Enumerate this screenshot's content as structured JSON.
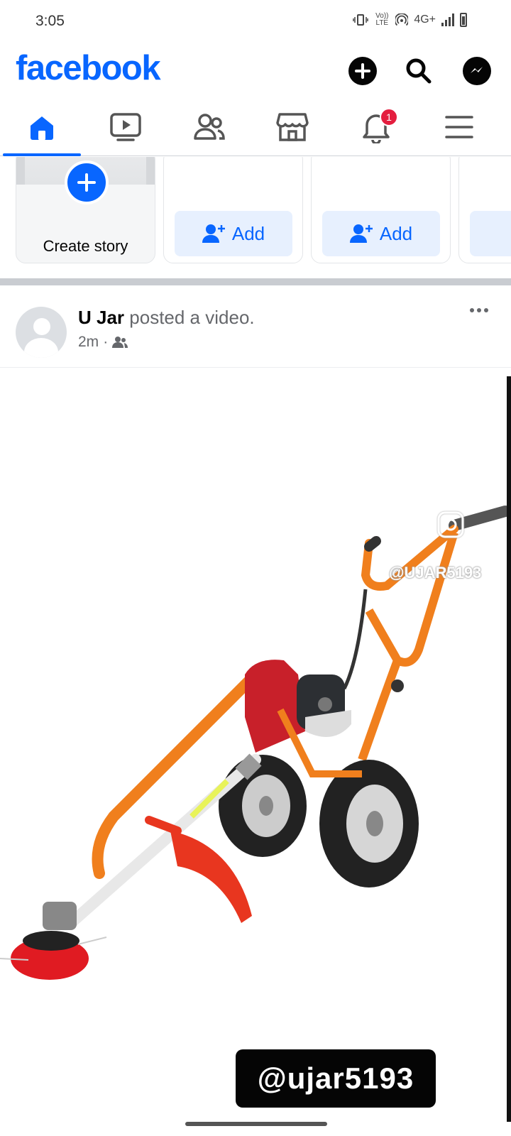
{
  "status_bar": {
    "time": "3:05",
    "network": "4G+",
    "volte": "Vo)) LTE"
  },
  "header": {
    "logo": "facebook"
  },
  "tabs": [
    {
      "name": "home",
      "icon": "home-icon",
      "active": true
    },
    {
      "name": "video",
      "icon": "video-icon"
    },
    {
      "name": "friends",
      "icon": "friends-icon"
    },
    {
      "name": "marketplace",
      "icon": "marketplace-icon"
    },
    {
      "name": "notifications",
      "icon": "bell-icon",
      "badge": "1"
    },
    {
      "name": "menu",
      "icon": "menu-icon"
    }
  ],
  "stories": {
    "create_label": "Create story",
    "add_label": "Add"
  },
  "post": {
    "author": "U Jar",
    "action": " posted a video.",
    "time": "2m",
    "separator": "·",
    "audience_icon": "friends-audience-icon",
    "video": {
      "watermark_top": "@UJAR5193",
      "watermark_bottom": "@ujar5193"
    }
  },
  "colors": {
    "brand": "#0866ff",
    "badge": "#e41e3f",
    "add_bg": "#e7f0fe"
  }
}
